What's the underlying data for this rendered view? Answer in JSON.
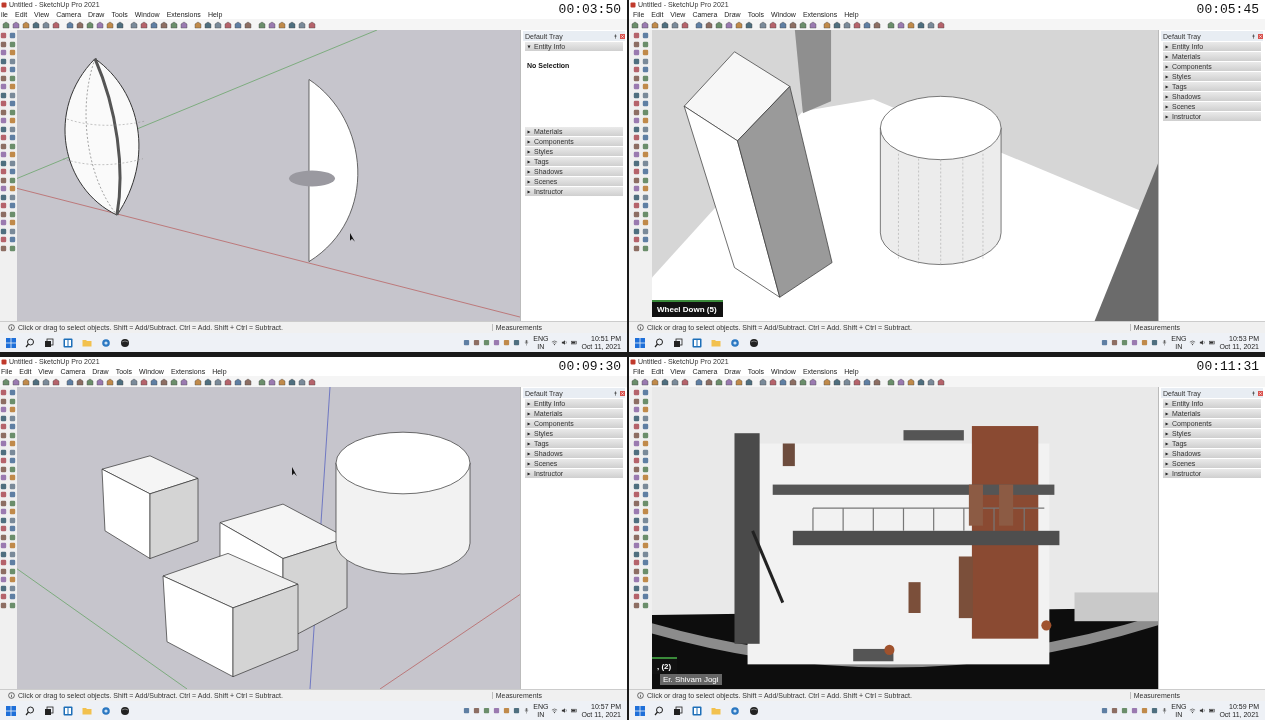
{
  "panels": [
    {
      "title": "Untitled - SketchUp Pro 2021",
      "timestamp": "00:03:50",
      "menu": [
        "ile",
        "Edit",
        "View",
        "Camera",
        "Draw",
        "Tools",
        "Window",
        "Extensions",
        "Help"
      ],
      "kind": "lenses",
      "tray": {
        "title": "Default Tray",
        "sections": [
          {
            "label": "Entity Info",
            "expanded": true,
            "content": "No Selection"
          },
          {
            "label": "Materials",
            "expanded": false
          },
          {
            "label": "Components",
            "expanded": false
          },
          {
            "label": "Styles",
            "expanded": false
          },
          {
            "label": "Tags",
            "expanded": false
          },
          {
            "label": "Shadows",
            "expanded": false
          },
          {
            "label": "Scenes",
            "expanded": false
          },
          {
            "label": "Instructor",
            "expanded": false
          }
        ]
      },
      "status": "Click or drag to select objects. Shift = Add/Subtract. Ctrl = Add. Shift + Ctrl = Subtract.",
      "measurements": "Measurements",
      "clock": {
        "lang": "ENG",
        "region": "IN",
        "time": "10:51 PM",
        "date": "Oct 11, 2021"
      }
    },
    {
      "title": "Untitled - SketchUp Pro 2021",
      "timestamp": "00:05:45",
      "menu": [
        "File",
        "Edit",
        "View",
        "Camera",
        "Draw",
        "Tools",
        "Window",
        "Extensions",
        "Help"
      ],
      "kind": "box-cylinder",
      "overlays": [
        {
          "kind": "label",
          "text": "Wheel Down (5)"
        }
      ],
      "tray": {
        "title": "Default Tray",
        "sections": [
          {
            "label": "Entity Info",
            "expanded": false
          },
          {
            "label": "Materials",
            "expanded": false
          },
          {
            "label": "Components",
            "expanded": false
          },
          {
            "label": "Styles",
            "expanded": false
          },
          {
            "label": "Tags",
            "expanded": false
          },
          {
            "label": "Shadows",
            "expanded": false
          },
          {
            "label": "Scenes",
            "expanded": false
          },
          {
            "label": "Instructor",
            "expanded": false
          }
        ]
      },
      "status": "Click or drag to select objects. Shift = Add/Subtract. Ctrl = Add. Shift + Ctrl = Subtract.",
      "measurements": "Measurements",
      "clock": {
        "lang": "ENG",
        "region": "IN",
        "time": "10:53 PM",
        "date": "Oct 11, 2021"
      }
    },
    {
      "title": "Untitled - SketchUp Pro 2021",
      "timestamp": "00:09:30",
      "menu": [
        "File",
        "Edit",
        "View",
        "Camera",
        "Draw",
        "Tools",
        "Window",
        "Extensions",
        "Help"
      ],
      "kind": "boxes",
      "tray": {
        "title": "Default Tray",
        "sections": [
          {
            "label": "Entity Info",
            "expanded": false
          },
          {
            "label": "Materials",
            "expanded": false
          },
          {
            "label": "Components",
            "expanded": false
          },
          {
            "label": "Styles",
            "expanded": false
          },
          {
            "label": "Tags",
            "expanded": false
          },
          {
            "label": "Shadows",
            "expanded": false
          },
          {
            "label": "Scenes",
            "expanded": false
          },
          {
            "label": "Instructor",
            "expanded": false
          }
        ]
      },
      "status": "Click or drag to select objects. Shift = Add/Subtract. Ctrl = Add. Shift + Ctrl = Subtract.",
      "measurements": "Measurements",
      "clock": {
        "lang": "ENG",
        "region": "IN",
        "time": "10:57 PM",
        "date": "Oct 11, 2021"
      }
    },
    {
      "title": "Untitled - SketchUp Pro 2021",
      "timestamp": "00:11:31",
      "menu": [
        "File",
        "Edit",
        "View",
        "Camera",
        "Draw",
        "Tools",
        "Window",
        "Extensions",
        "Help"
      ],
      "kind": "house",
      "overlays": [
        {
          "kind": "label",
          "text": ", (2)"
        },
        {
          "kind": "credit",
          "text": "Er. Shivam Jogi"
        }
      ],
      "tray": {
        "title": "Default Tray",
        "sections": [
          {
            "label": "Entity Info",
            "expanded": false
          },
          {
            "label": "Materials",
            "expanded": false
          },
          {
            "label": "Components",
            "expanded": false
          },
          {
            "label": "Styles",
            "expanded": false
          },
          {
            "label": "Tags",
            "expanded": false
          },
          {
            "label": "Shadows",
            "expanded": false
          },
          {
            "label": "Scenes",
            "expanded": false
          },
          {
            "label": "Instructor",
            "expanded": false
          }
        ]
      },
      "status": "Click or drag to select objects. Shift = Add/Subtract. Ctrl = Add. Shift + Ctrl = Subtract.",
      "measurements": "Measurements",
      "clock": {
        "lang": "ENG",
        "region": "IN",
        "time": "10:59 PM",
        "date": "Oct 11, 2021"
      }
    }
  ]
}
